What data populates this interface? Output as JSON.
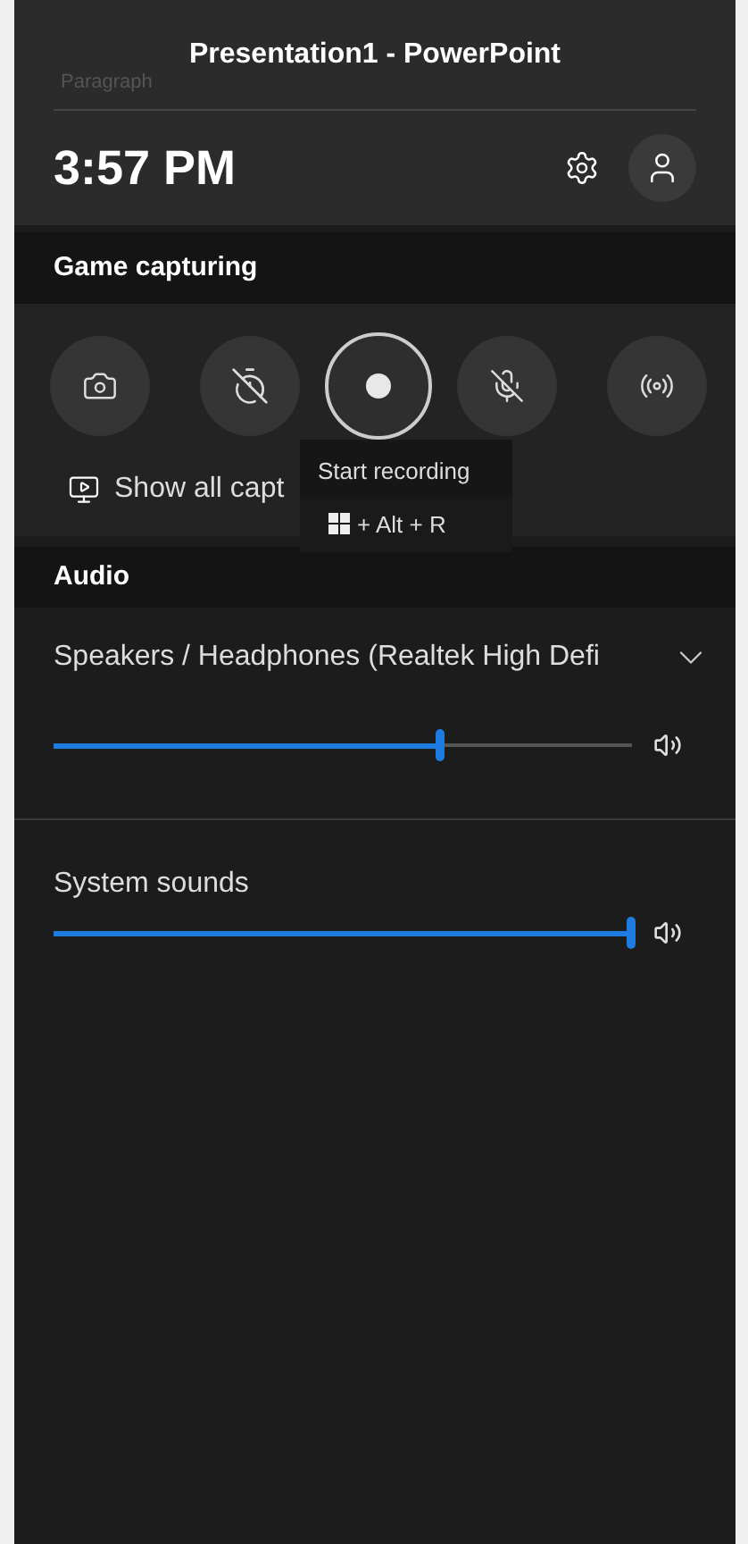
{
  "window": {
    "title": "Presentation1 - PowerPoint",
    "background_text": "Paragraph"
  },
  "header": {
    "time": "3:57 PM"
  },
  "game_capturing": {
    "title": "Game capturing",
    "button_groups": [
      [
        {
          "kind": "screenshot"
        }
      ],
      [
        {
          "kind": "record_last"
        },
        {
          "kind": "record"
        },
        {
          "kind": "mic"
        }
      ],
      [
        {
          "kind": "broadcast"
        }
      ]
    ],
    "show_all_label": "Show all capt",
    "tooltip": {
      "title": "Start recording",
      "shortcut": "+ Alt + R"
    }
  },
  "audio": {
    "title": "Audio",
    "device": "Speakers / Headphones (Realtek High Defi",
    "channels": [
      {
        "level": 0.67
      },
      {
        "name": "System sounds",
        "level": 1
      }
    ]
  }
}
